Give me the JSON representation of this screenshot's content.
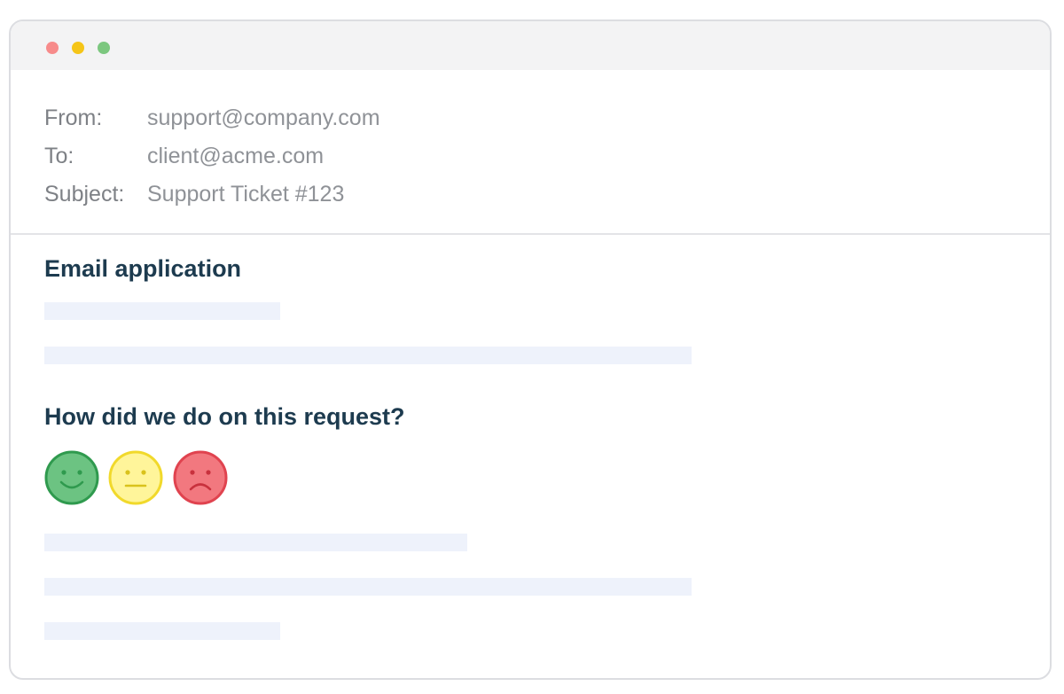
{
  "window": {
    "controls": [
      "close",
      "minimize",
      "maximize"
    ],
    "colors": {
      "close": "#f78b8b",
      "minimize": "#f5c518",
      "maximize": "#7cc77f"
    }
  },
  "email": {
    "from_label": "From:",
    "from_value": "support@company.com",
    "to_label": "To:",
    "to_value": "client@acme.com",
    "subject_label": "Subject:",
    "subject_value": "Support Ticket #123"
  },
  "body": {
    "heading": "Email application",
    "question": "How did we do on this request?",
    "ratings": [
      {
        "icon": "happy-face-icon",
        "color": "#3daa5c"
      },
      {
        "icon": "neutral-face-icon",
        "color": "#f3e52a"
      },
      {
        "icon": "sad-face-icon",
        "color": "#e5485a"
      }
    ]
  }
}
